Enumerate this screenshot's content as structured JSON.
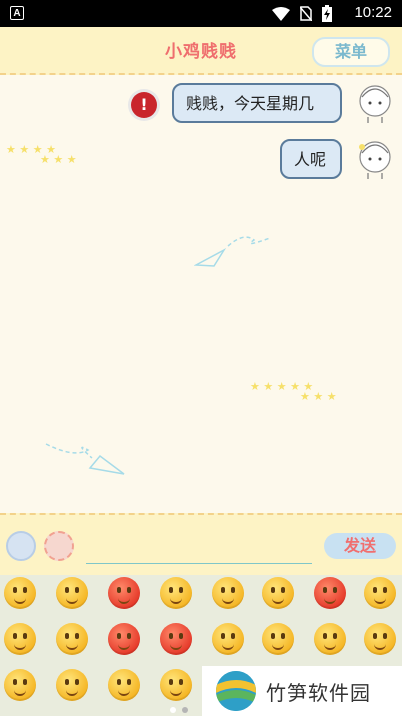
{
  "status_bar": {
    "left_icon_label": "A",
    "time": "10:22",
    "icons": [
      "wifi-icon",
      "no-sim-icon",
      "battery-charging-icon"
    ]
  },
  "header": {
    "title": "小鸡贱贱",
    "menu_label": "菜单"
  },
  "messages": [
    {
      "text": "贱贱，今天星期几",
      "sender": "user",
      "error": true,
      "error_glyph": "!"
    },
    {
      "text": "人呢",
      "sender": "user",
      "error": false
    }
  ],
  "input_bar": {
    "send_label": "发送",
    "input_value": ""
  },
  "emoji_panel": {
    "page_count": 2,
    "active_page": 2,
    "rows": 3,
    "columns": 8
  },
  "watermark": {
    "text": "竹笋软件园"
  },
  "colors": {
    "header_bg": "#fdf3c5",
    "chat_bg": "#fdf9ec",
    "bubble_bg": "#dce9f5",
    "bubble_border": "#5a7b9b",
    "title_color": "#ef6e6e",
    "send_color": "#f06f6f",
    "menu_color": "#7bb9ce"
  }
}
